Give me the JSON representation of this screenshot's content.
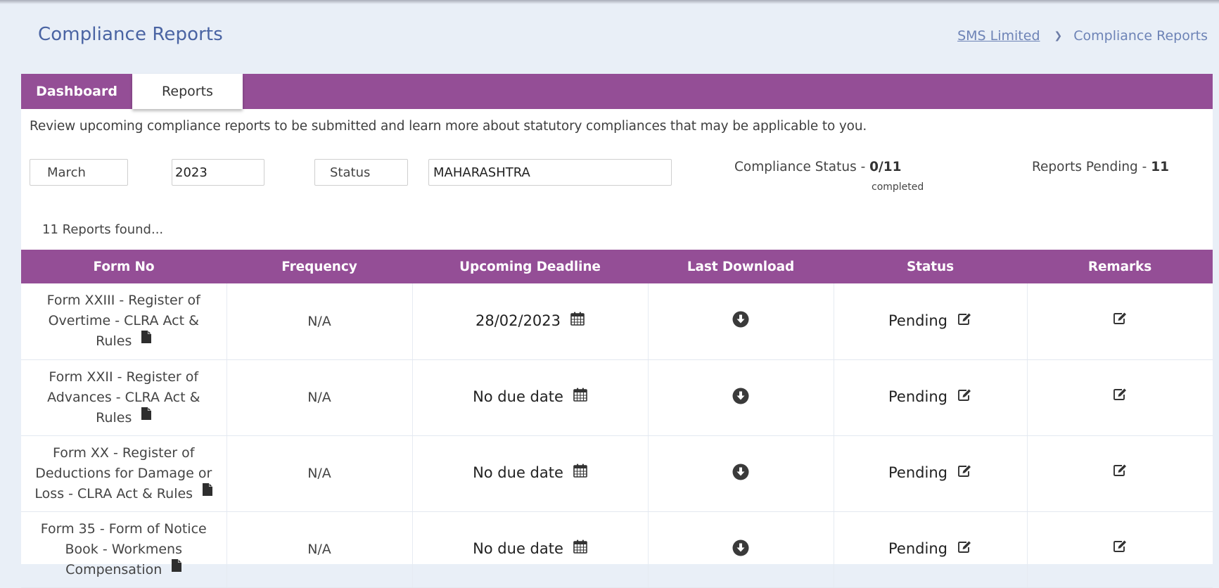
{
  "header": {
    "title": "Compliance Reports",
    "breadcrumb": [
      {
        "label": "SMS Limited",
        "link": true
      },
      {
        "label": "Compliance Reports",
        "link": false
      }
    ],
    "breadcrumb_separator": "chevron-right-icon"
  },
  "tabs": [
    {
      "label": "Dashboard",
      "active": false
    },
    {
      "label": "Reports",
      "active": true
    }
  ],
  "intro": "Review upcoming compliance reports to be submitted and learn more about statutory compliances that may be applicable to you.",
  "filters": {
    "month": "March",
    "year": "2023",
    "status": "Status",
    "state": "MAHARASHTRA"
  },
  "stats": {
    "compliance_label": "Compliance Status - ",
    "compliance_value": "0/11",
    "compliance_sub": "completed",
    "pending_label": "Reports Pending - ",
    "pending_value": "11"
  },
  "results_text": "11 Reports found...",
  "table": {
    "columns": [
      "Form No",
      "Frequency",
      "Upcoming Deadline",
      "Last Download",
      "Status",
      "Remarks"
    ],
    "rows": [
      {
        "form": "Form XXIII - Register of Overtime - CLRA Act & Rules",
        "frequency": "N/A",
        "deadline": "28/02/2023",
        "status": "Pending"
      },
      {
        "form": "Form XXII - Register of Advances - CLRA Act & Rules",
        "frequency": "N/A",
        "deadline": "No due date",
        "status": "Pending"
      },
      {
        "form": "Form XX - Register of Deductions for Damage or Loss - CLRA Act & Rules",
        "frequency": "N/A",
        "deadline": "No due date",
        "status": "Pending"
      },
      {
        "form": "Form 35 - Form of Notice Book - Workmens Compensation",
        "frequency": "N/A",
        "deadline": "No due date",
        "status": "Pending"
      }
    ]
  },
  "icons": {
    "form_doc": "file-icon",
    "deadline": "calendar-icon",
    "download": "download-circle-icon",
    "status_edit": "edit-icon",
    "remarks_edit": "edit-icon"
  },
  "colors": {
    "brand_purple": "#944e96",
    "title_blue": "#4a64a3",
    "breadcrumb": "#6d83b6",
    "page_bg": "#e9eff7"
  }
}
